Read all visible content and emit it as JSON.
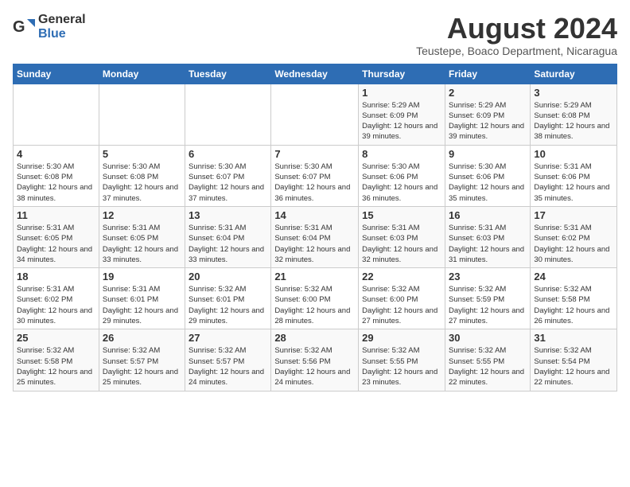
{
  "header": {
    "logo_general": "General",
    "logo_blue": "Blue",
    "title": "August 2024",
    "subtitle": "Teustepe, Boaco Department, Nicaragua"
  },
  "weekdays": [
    "Sunday",
    "Monday",
    "Tuesday",
    "Wednesday",
    "Thursday",
    "Friday",
    "Saturday"
  ],
  "weeks": [
    [
      {
        "day": "",
        "info": ""
      },
      {
        "day": "",
        "info": ""
      },
      {
        "day": "",
        "info": ""
      },
      {
        "day": "",
        "info": ""
      },
      {
        "day": "1",
        "info": "Sunrise: 5:29 AM\nSunset: 6:09 PM\nDaylight: 12 hours and 39 minutes."
      },
      {
        "day": "2",
        "info": "Sunrise: 5:29 AM\nSunset: 6:09 PM\nDaylight: 12 hours and 39 minutes."
      },
      {
        "day": "3",
        "info": "Sunrise: 5:29 AM\nSunset: 6:08 PM\nDaylight: 12 hours and 38 minutes."
      }
    ],
    [
      {
        "day": "4",
        "info": "Sunrise: 5:30 AM\nSunset: 6:08 PM\nDaylight: 12 hours and 38 minutes."
      },
      {
        "day": "5",
        "info": "Sunrise: 5:30 AM\nSunset: 6:08 PM\nDaylight: 12 hours and 37 minutes."
      },
      {
        "day": "6",
        "info": "Sunrise: 5:30 AM\nSunset: 6:07 PM\nDaylight: 12 hours and 37 minutes."
      },
      {
        "day": "7",
        "info": "Sunrise: 5:30 AM\nSunset: 6:07 PM\nDaylight: 12 hours and 36 minutes."
      },
      {
        "day": "8",
        "info": "Sunrise: 5:30 AM\nSunset: 6:06 PM\nDaylight: 12 hours and 36 minutes."
      },
      {
        "day": "9",
        "info": "Sunrise: 5:30 AM\nSunset: 6:06 PM\nDaylight: 12 hours and 35 minutes."
      },
      {
        "day": "10",
        "info": "Sunrise: 5:31 AM\nSunset: 6:06 PM\nDaylight: 12 hours and 35 minutes."
      }
    ],
    [
      {
        "day": "11",
        "info": "Sunrise: 5:31 AM\nSunset: 6:05 PM\nDaylight: 12 hours and 34 minutes."
      },
      {
        "day": "12",
        "info": "Sunrise: 5:31 AM\nSunset: 6:05 PM\nDaylight: 12 hours and 33 minutes."
      },
      {
        "day": "13",
        "info": "Sunrise: 5:31 AM\nSunset: 6:04 PM\nDaylight: 12 hours and 33 minutes."
      },
      {
        "day": "14",
        "info": "Sunrise: 5:31 AM\nSunset: 6:04 PM\nDaylight: 12 hours and 32 minutes."
      },
      {
        "day": "15",
        "info": "Sunrise: 5:31 AM\nSunset: 6:03 PM\nDaylight: 12 hours and 32 minutes."
      },
      {
        "day": "16",
        "info": "Sunrise: 5:31 AM\nSunset: 6:03 PM\nDaylight: 12 hours and 31 minutes."
      },
      {
        "day": "17",
        "info": "Sunrise: 5:31 AM\nSunset: 6:02 PM\nDaylight: 12 hours and 30 minutes."
      }
    ],
    [
      {
        "day": "18",
        "info": "Sunrise: 5:31 AM\nSunset: 6:02 PM\nDaylight: 12 hours and 30 minutes."
      },
      {
        "day": "19",
        "info": "Sunrise: 5:31 AM\nSunset: 6:01 PM\nDaylight: 12 hours and 29 minutes."
      },
      {
        "day": "20",
        "info": "Sunrise: 5:32 AM\nSunset: 6:01 PM\nDaylight: 12 hours and 29 minutes."
      },
      {
        "day": "21",
        "info": "Sunrise: 5:32 AM\nSunset: 6:00 PM\nDaylight: 12 hours and 28 minutes."
      },
      {
        "day": "22",
        "info": "Sunrise: 5:32 AM\nSunset: 6:00 PM\nDaylight: 12 hours and 27 minutes."
      },
      {
        "day": "23",
        "info": "Sunrise: 5:32 AM\nSunset: 5:59 PM\nDaylight: 12 hours and 27 minutes."
      },
      {
        "day": "24",
        "info": "Sunrise: 5:32 AM\nSunset: 5:58 PM\nDaylight: 12 hours and 26 minutes."
      }
    ],
    [
      {
        "day": "25",
        "info": "Sunrise: 5:32 AM\nSunset: 5:58 PM\nDaylight: 12 hours and 25 minutes."
      },
      {
        "day": "26",
        "info": "Sunrise: 5:32 AM\nSunset: 5:57 PM\nDaylight: 12 hours and 25 minutes."
      },
      {
        "day": "27",
        "info": "Sunrise: 5:32 AM\nSunset: 5:57 PM\nDaylight: 12 hours and 24 minutes."
      },
      {
        "day": "28",
        "info": "Sunrise: 5:32 AM\nSunset: 5:56 PM\nDaylight: 12 hours and 24 minutes."
      },
      {
        "day": "29",
        "info": "Sunrise: 5:32 AM\nSunset: 5:55 PM\nDaylight: 12 hours and 23 minutes."
      },
      {
        "day": "30",
        "info": "Sunrise: 5:32 AM\nSunset: 5:55 PM\nDaylight: 12 hours and 22 minutes."
      },
      {
        "day": "31",
        "info": "Sunrise: 5:32 AM\nSunset: 5:54 PM\nDaylight: 12 hours and 22 minutes."
      }
    ]
  ]
}
